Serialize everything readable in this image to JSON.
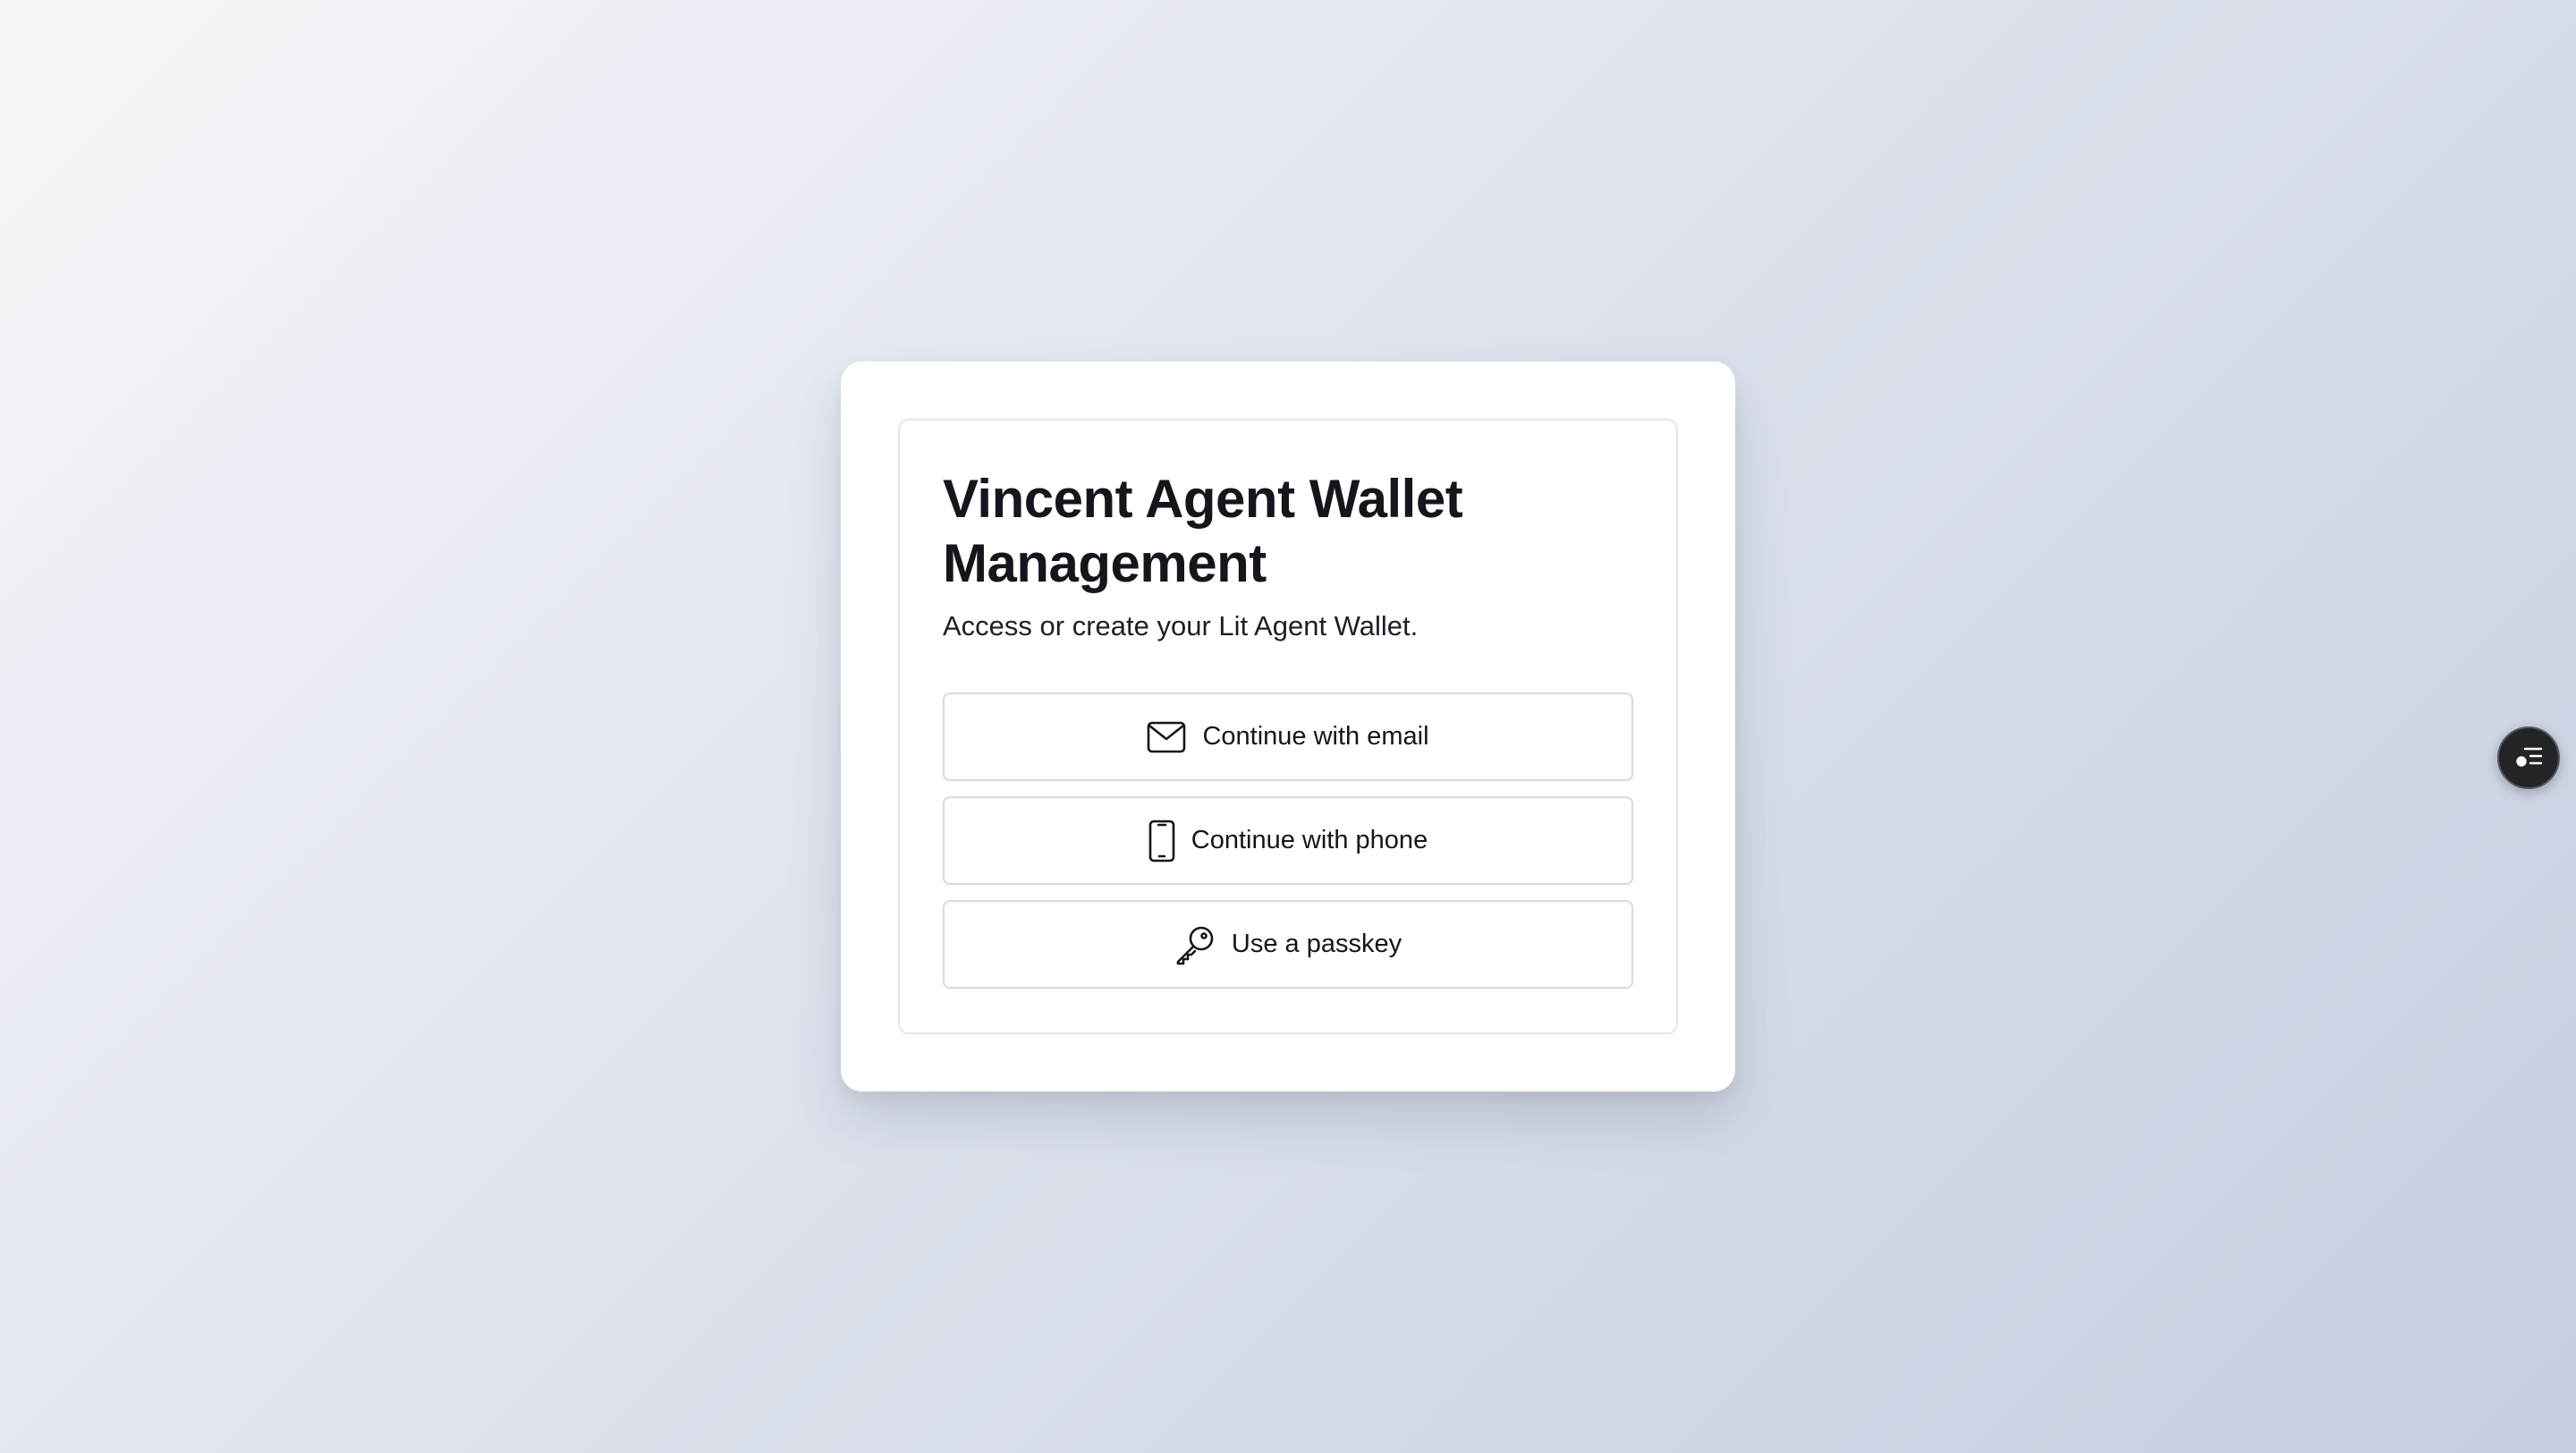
{
  "card": {
    "title": "Vincent Agent Wallet Management",
    "subtitle": "Access or create your Lit Agent Wallet."
  },
  "auth_options": [
    {
      "label": "Continue with email",
      "icon": "mail-icon"
    },
    {
      "label": "Continue with phone",
      "icon": "smartphone-icon"
    },
    {
      "label": "Use a passkey",
      "icon": "key-icon"
    }
  ],
  "floating_button": {
    "icon": "list-settings-icon"
  },
  "colors": {
    "background_start": "#f6f7fa",
    "background_end": "#c6cfe0",
    "card": "#ffffff",
    "text": "#14161c",
    "button_border": "#d6d9df",
    "fab": "#222428"
  }
}
